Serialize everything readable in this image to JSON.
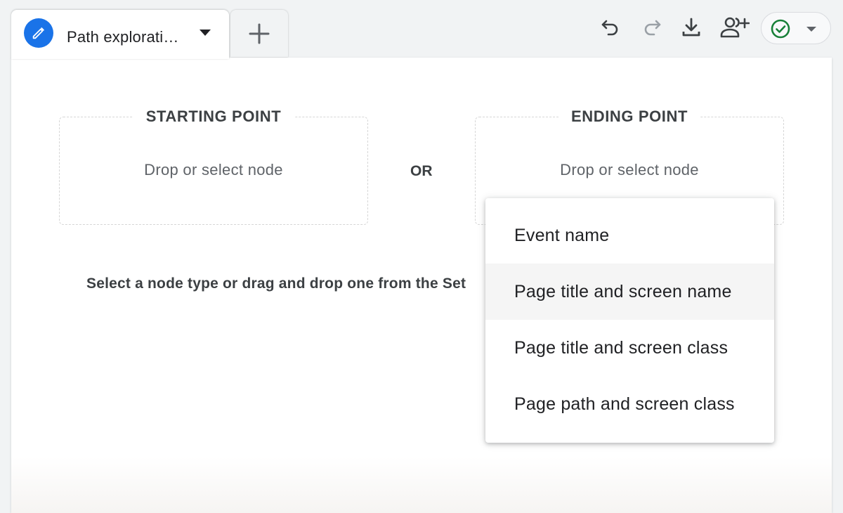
{
  "tab": {
    "title": "Path explorati…",
    "edit_icon": "pencil-icon",
    "dropdown_icon": "caret-down-icon"
  },
  "add_tab": {
    "icon": "plus-icon"
  },
  "toolbar": {
    "icons": [
      "undo-icon",
      "redo-icon",
      "download-icon",
      "share-user-icon"
    ],
    "status_icon": "check-circle-icon"
  },
  "canvas": {
    "starting_point": {
      "label": "STARTING POINT",
      "placeholder": "Drop or select node"
    },
    "or_label": "OR",
    "ending_point": {
      "label": "ENDING POINT",
      "placeholder": "Drop or select node"
    },
    "instructions": "Select a node type or drag and drop one from the Set"
  },
  "node_type_menu": {
    "items": [
      {
        "label": "Event name"
      },
      {
        "label": "Page title and screen name"
      },
      {
        "label": "Page title and screen class"
      },
      {
        "label": "Page path and screen class"
      }
    ],
    "hovered_index": 1
  },
  "colors": {
    "accent_blue": "#1a73e8",
    "status_green": "#188038",
    "disabled_gray": "#9aa0a6",
    "icon_gray": "#5f6368"
  }
}
